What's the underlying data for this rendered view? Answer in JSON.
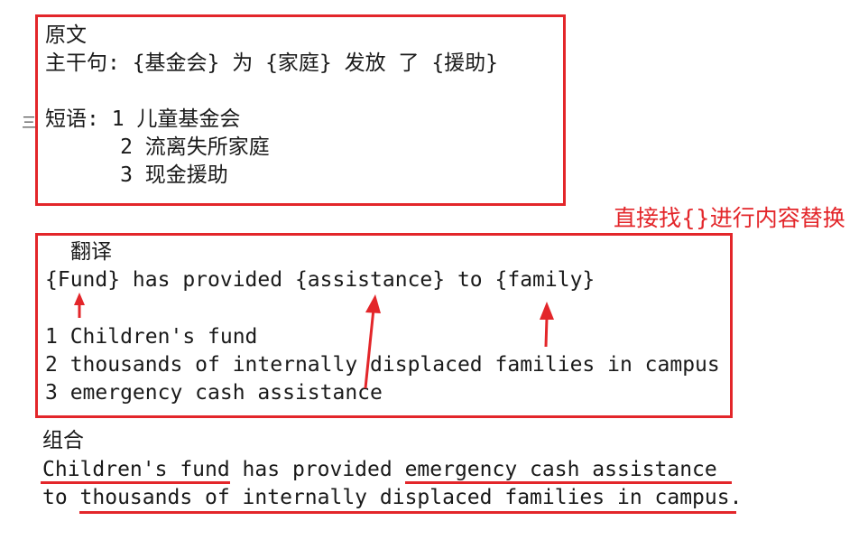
{
  "source": {
    "heading": "原文",
    "main_clause": "主干句: {基金会} 为 {家庭} 发放 了 {援助}",
    "phrases_label": "短语: 1 儿童基金会",
    "phrase2": "      2 流离失所家庭",
    "phrase3": "      3 现金援助",
    "margin_glyph": "三"
  },
  "note": "直接找{}进行内容替换",
  "translation": {
    "heading": "翻译",
    "main_clause": "{Fund} has provided {assistance} to {family}",
    "phrase1": "1 Children's fund",
    "phrase2": "2 thousands of internally displaced families in campus",
    "phrase3": "3 emergency cash assistance"
  },
  "combination": {
    "heading": "组合",
    "line1": "Children's fund has provided emergency cash assistance",
    "line2": "to thousands of internally displaced families in campus."
  },
  "colors": {
    "accent": "#e3262a"
  }
}
